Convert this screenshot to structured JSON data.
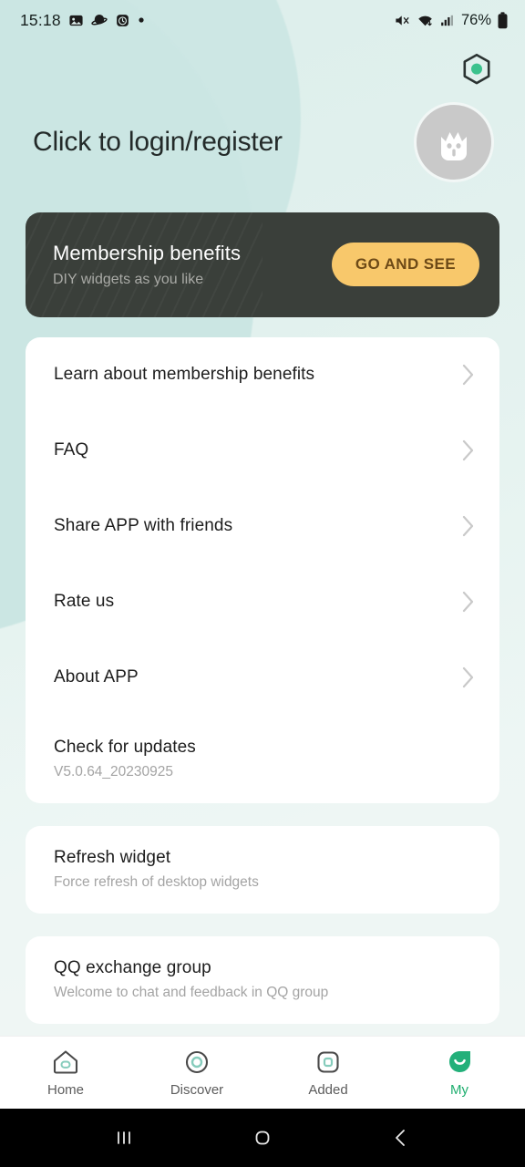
{
  "status_bar": {
    "time": "15:18",
    "battery_percent": "76%",
    "left_icons": [
      "image-icon",
      "planet-icon",
      "alarm-icon",
      "dot-icon"
    ],
    "right_icons": [
      "mute-icon",
      "wifi-icon",
      "cellular-signal-icon",
      "battery-icon"
    ]
  },
  "header": {
    "hexagon_icon": "hexagon-scan-icon",
    "login_text": "Click to login/register",
    "avatar_icon": "cat-avatar-icon"
  },
  "banner": {
    "title": "Membership benefits",
    "subtitle": "DIY widgets as you like",
    "button_label": "GO AND SEE",
    "bg_color": "#3a3f3a",
    "button_color": "#f8c86b",
    "button_text_color": "#6d4a17"
  },
  "cards": [
    {
      "name": "main-menu-card",
      "rows": [
        {
          "title": "Learn about membership benefits",
          "subtitle": "",
          "chevron": true
        },
        {
          "title": "FAQ",
          "subtitle": "",
          "chevron": true
        },
        {
          "title": "Share APP with friends",
          "subtitle": "",
          "chevron": true
        },
        {
          "title": "Rate us",
          "subtitle": "",
          "chevron": true
        },
        {
          "title": "About APP",
          "subtitle": "",
          "chevron": true
        },
        {
          "title": "Check for updates",
          "subtitle": "V5.0.64_20230925",
          "chevron": false
        }
      ]
    },
    {
      "name": "refresh-widget-card",
      "rows": [
        {
          "title": "Refresh widget",
          "subtitle": "Force refresh of desktop widgets",
          "chevron": false
        }
      ]
    },
    {
      "name": "qq-group-card",
      "rows": [
        {
          "title": "QQ exchange group",
          "subtitle": "Welcome to chat and feedback in QQ group",
          "chevron": false
        }
      ]
    }
  ],
  "bottom_nav": {
    "active_color": "#1fae6f",
    "items": [
      {
        "label": "Home",
        "icon": "home-icon",
        "active": false
      },
      {
        "label": "Discover",
        "icon": "discover-icon",
        "active": false
      },
      {
        "label": "Added",
        "icon": "added-icon",
        "active": false
      },
      {
        "label": "My",
        "icon": "my-leaf-icon",
        "active": true
      }
    ]
  },
  "system_nav": {
    "recents": "recents-icon",
    "home": "home-circle-icon",
    "back": "back-icon"
  }
}
